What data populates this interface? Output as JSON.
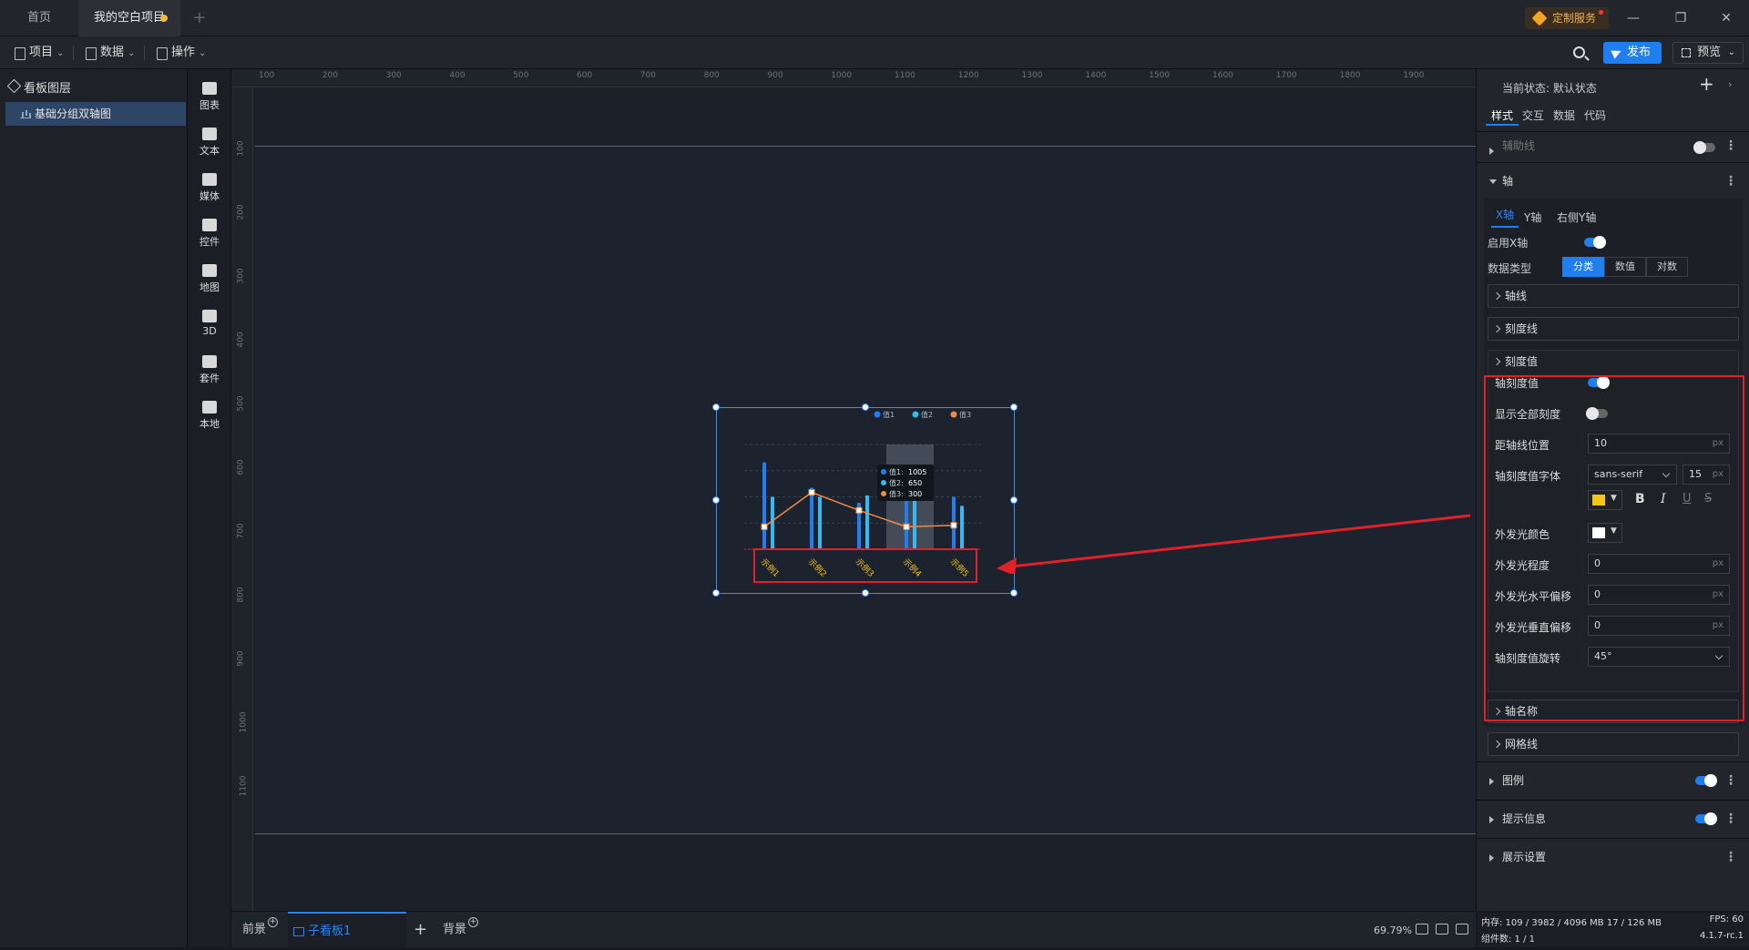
{
  "tabs": {
    "home": "首页",
    "project": "我的空白项目"
  },
  "custom_service": "定制服务",
  "toolbar": {
    "project": "项目",
    "data": "数据",
    "ops": "操作",
    "publish": "发布",
    "preview": "预览"
  },
  "layers": {
    "title": "看板图层",
    "item": "基础分组双轴图"
  },
  "rail": [
    "图表",
    "文本",
    "媒体",
    "控件",
    "地图",
    "3D",
    "套件",
    "本地"
  ],
  "ruler_h": [
    "100",
    "200",
    "300",
    "400",
    "500",
    "600",
    "700",
    "800",
    "900",
    "1000",
    "1100",
    "1200",
    "1300",
    "1400",
    "1500",
    "1600",
    "1700",
    "1800",
    "1900"
  ],
  "ruler_v": [
    "100",
    "200",
    "300",
    "400",
    "500",
    "600",
    "700",
    "800",
    "900",
    "1000",
    "1100"
  ],
  "chart_data": {
    "type": "bar",
    "categories": [
      "示例1",
      "示例2",
      "示例3",
      "示例4",
      "示例5"
    ],
    "series": [
      {
        "name": "值1",
        "kind": "bar",
        "color": "#1f7ff0",
        "values": [
          1160,
          820,
          620,
          1005,
          700
        ]
      },
      {
        "name": "值2",
        "kind": "bar",
        "color": "#35b9f0",
        "values": [
          700,
          700,
          720,
          650,
          580
        ]
      },
      {
        "name": "值3",
        "kind": "line",
        "color": "#f08a4b",
        "values": [
          300,
          760,
          520,
          300,
          320
        ]
      }
    ],
    "ylim": [
      0,
      1400
    ],
    "legend": "top-right",
    "tooltip": {
      "rows": [
        {
          "label": "值1:",
          "value": "1005"
        },
        {
          "label": "值2:",
          "value": "650"
        },
        {
          "label": "值3:",
          "value": "300"
        }
      ]
    },
    "highlight_index": 3,
    "tick_label_color": "#f5c518",
    "tick_rotation": "45°"
  },
  "bottom": {
    "front": "前景",
    "board": "子看板1",
    "background": "背景",
    "zoom": "69.79%"
  },
  "status": {
    "memory": "内存: 109 / 3982 / 4096 MB  17 / 126 MB",
    "fps": "FPS: 60",
    "components": "组件数: 1 / 1",
    "version": "4.1.7-rc.1"
  },
  "panel": {
    "state": "当前状态: 默认状态",
    "tabs": [
      "样式",
      "交互",
      "数据",
      "代码"
    ],
    "aux_line": "辅助线",
    "axis": "轴",
    "axis_tabs": [
      "X轴",
      "Y轴",
      "右侧Y轴"
    ],
    "enable_x": "启用X轴",
    "data_type": "数据类型",
    "data_type_opts": [
      "分类",
      "数值",
      "对数"
    ],
    "axis_line": "轴线",
    "tick_line": "刻度线",
    "tick_value": "刻度值",
    "f_tick_value": "轴刻度值",
    "f_show_all": "显示全部刻度",
    "f_distance": "距轴线位置",
    "f_distance_val": "10",
    "f_font": "轴刻度值字体",
    "f_font_val": "sans-serif",
    "f_font_size": "15",
    "f_glow_color": "外发光颜色",
    "f_glow": "外发光程度",
    "f_glow_val": "0",
    "f_glow_x": "外发光水平偏移",
    "f_glow_x_val": "0",
    "f_glow_y": "外发光垂直偏移",
    "f_glow_y_val": "0",
    "f_rotate": "轴刻度值旋转",
    "f_rotate_val": "45°",
    "unit": "px",
    "axis_name": "轴名称",
    "grid_line": "网格线",
    "legend": "图例",
    "tooltip": "提示信息",
    "display": "展示设置",
    "font_color": "#f5c518",
    "glow_color": "#ffffff"
  }
}
